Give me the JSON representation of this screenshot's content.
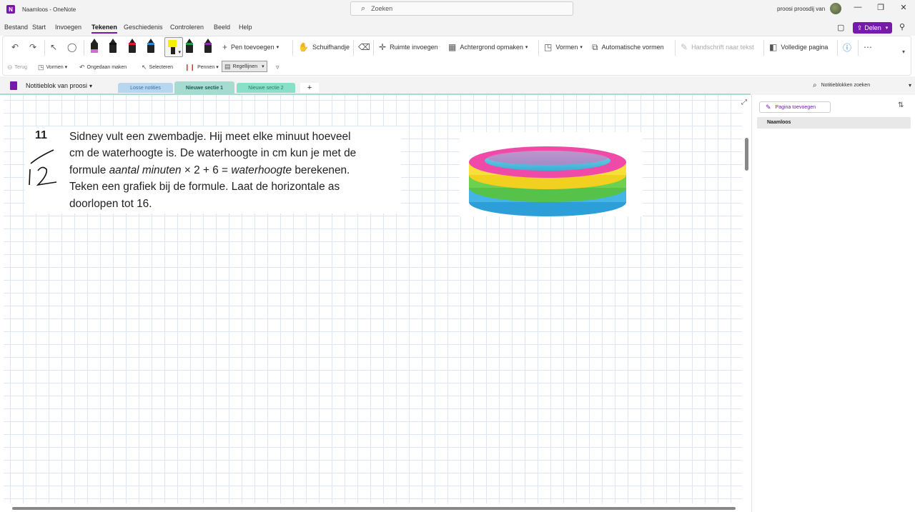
{
  "window": {
    "title": "Naamloos - OneNote",
    "search_placeholder": "Zoeken",
    "user": "proosi proosdij van"
  },
  "menu": {
    "items": [
      "Bestand",
      "Start",
      "Invoegen",
      "Tekenen",
      "Geschiedenis",
      "Controleren",
      "Beeld",
      "Help"
    ],
    "share_label": "Delen"
  },
  "ribbon": {
    "pen_add": "Pen toevoegen",
    "pan": "Schuifhandje",
    "insert_space": "Ruimte invoegen",
    "background": "Achtergrond opmaken",
    "shapes": "Vormen",
    "auto_shapes": "Automatische vormen",
    "ink_to_text": "Handschrift naar tekst",
    "full_page": "Volledige pagina",
    "back": "Terug",
    "shapes2": "Vormen",
    "undo": "Ongedaan maken",
    "select": "Selecteren",
    "pens": "Pennen",
    "rule_lines": "Regellijnen"
  },
  "notebook": {
    "name": "Notitieblok van proosi",
    "tabs": [
      "Losse notities",
      "Nieuwe sectie 1",
      "Nieuwe sectie 2"
    ],
    "search_placeholder": "Notitieblokken zoeken",
    "tab_colors": [
      "#b7d7f0",
      "#a6dcd0",
      "#88e0c8"
    ]
  },
  "page": {
    "exercise_number": "11",
    "handwritten": "12",
    "line1": "Sidney vult een zwembadje. Hij meet elke minuut hoeveel",
    "line2": "cm de waterhoogte is. De waterhoogte in cm kun je met de",
    "line3_a": "formule ",
    "line3_italic1": "aantal minuten",
    "line3_b": " × 2 + 6 = ",
    "line3_italic2": "waterhoogte",
    "line3_c": " berekenen.",
    "line4": "Teken een grafiek bij de formule. Laat de horizontale as",
    "line5": "doorlopen tot 16."
  },
  "pages_panel": {
    "add_page": "Pagina toevoegen",
    "pages": [
      "Naamloos"
    ]
  },
  "colors": {
    "accent": "#7719aa"
  }
}
